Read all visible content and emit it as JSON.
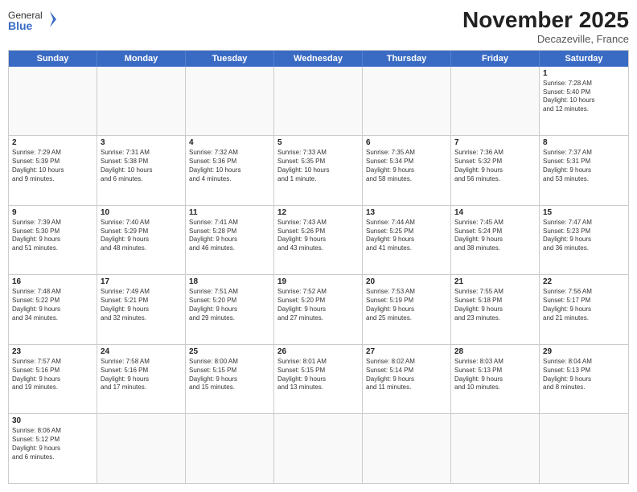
{
  "header": {
    "logo_general": "General",
    "logo_blue": "Blue",
    "month_title": "November 2025",
    "location": "Decazeville, France"
  },
  "day_headers": [
    "Sunday",
    "Monday",
    "Tuesday",
    "Wednesday",
    "Thursday",
    "Friday",
    "Saturday"
  ],
  "weeks": [
    {
      "days": [
        {
          "num": "",
          "info": ""
        },
        {
          "num": "",
          "info": ""
        },
        {
          "num": "",
          "info": ""
        },
        {
          "num": "",
          "info": ""
        },
        {
          "num": "",
          "info": ""
        },
        {
          "num": "",
          "info": ""
        },
        {
          "num": "1",
          "info": "Sunrise: 7:28 AM\nSunset: 5:40 PM\nDaylight: 10 hours\nand 12 minutes."
        }
      ]
    },
    {
      "days": [
        {
          "num": "2",
          "info": "Sunrise: 7:29 AM\nSunset: 5:39 PM\nDaylight: 10 hours\nand 9 minutes."
        },
        {
          "num": "3",
          "info": "Sunrise: 7:31 AM\nSunset: 5:38 PM\nDaylight: 10 hours\nand 6 minutes."
        },
        {
          "num": "4",
          "info": "Sunrise: 7:32 AM\nSunset: 5:36 PM\nDaylight: 10 hours\nand 4 minutes."
        },
        {
          "num": "5",
          "info": "Sunrise: 7:33 AM\nSunset: 5:35 PM\nDaylight: 10 hours\nand 1 minute."
        },
        {
          "num": "6",
          "info": "Sunrise: 7:35 AM\nSunset: 5:34 PM\nDaylight: 9 hours\nand 58 minutes."
        },
        {
          "num": "7",
          "info": "Sunrise: 7:36 AM\nSunset: 5:32 PM\nDaylight: 9 hours\nand 56 minutes."
        },
        {
          "num": "8",
          "info": "Sunrise: 7:37 AM\nSunset: 5:31 PM\nDaylight: 9 hours\nand 53 minutes."
        }
      ]
    },
    {
      "days": [
        {
          "num": "9",
          "info": "Sunrise: 7:39 AM\nSunset: 5:30 PM\nDaylight: 9 hours\nand 51 minutes."
        },
        {
          "num": "10",
          "info": "Sunrise: 7:40 AM\nSunset: 5:29 PM\nDaylight: 9 hours\nand 48 minutes."
        },
        {
          "num": "11",
          "info": "Sunrise: 7:41 AM\nSunset: 5:28 PM\nDaylight: 9 hours\nand 46 minutes."
        },
        {
          "num": "12",
          "info": "Sunrise: 7:43 AM\nSunset: 5:26 PM\nDaylight: 9 hours\nand 43 minutes."
        },
        {
          "num": "13",
          "info": "Sunrise: 7:44 AM\nSunset: 5:25 PM\nDaylight: 9 hours\nand 41 minutes."
        },
        {
          "num": "14",
          "info": "Sunrise: 7:45 AM\nSunset: 5:24 PM\nDaylight: 9 hours\nand 38 minutes."
        },
        {
          "num": "15",
          "info": "Sunrise: 7:47 AM\nSunset: 5:23 PM\nDaylight: 9 hours\nand 36 minutes."
        }
      ]
    },
    {
      "days": [
        {
          "num": "16",
          "info": "Sunrise: 7:48 AM\nSunset: 5:22 PM\nDaylight: 9 hours\nand 34 minutes."
        },
        {
          "num": "17",
          "info": "Sunrise: 7:49 AM\nSunset: 5:21 PM\nDaylight: 9 hours\nand 32 minutes."
        },
        {
          "num": "18",
          "info": "Sunrise: 7:51 AM\nSunset: 5:20 PM\nDaylight: 9 hours\nand 29 minutes."
        },
        {
          "num": "19",
          "info": "Sunrise: 7:52 AM\nSunset: 5:20 PM\nDaylight: 9 hours\nand 27 minutes."
        },
        {
          "num": "20",
          "info": "Sunrise: 7:53 AM\nSunset: 5:19 PM\nDaylight: 9 hours\nand 25 minutes."
        },
        {
          "num": "21",
          "info": "Sunrise: 7:55 AM\nSunset: 5:18 PM\nDaylight: 9 hours\nand 23 minutes."
        },
        {
          "num": "22",
          "info": "Sunrise: 7:56 AM\nSunset: 5:17 PM\nDaylight: 9 hours\nand 21 minutes."
        }
      ]
    },
    {
      "days": [
        {
          "num": "23",
          "info": "Sunrise: 7:57 AM\nSunset: 5:16 PM\nDaylight: 9 hours\nand 19 minutes."
        },
        {
          "num": "24",
          "info": "Sunrise: 7:58 AM\nSunset: 5:16 PM\nDaylight: 9 hours\nand 17 minutes."
        },
        {
          "num": "25",
          "info": "Sunrise: 8:00 AM\nSunset: 5:15 PM\nDaylight: 9 hours\nand 15 minutes."
        },
        {
          "num": "26",
          "info": "Sunrise: 8:01 AM\nSunset: 5:15 PM\nDaylight: 9 hours\nand 13 minutes."
        },
        {
          "num": "27",
          "info": "Sunrise: 8:02 AM\nSunset: 5:14 PM\nDaylight: 9 hours\nand 11 minutes."
        },
        {
          "num": "28",
          "info": "Sunrise: 8:03 AM\nSunset: 5:13 PM\nDaylight: 9 hours\nand 10 minutes."
        },
        {
          "num": "29",
          "info": "Sunrise: 8:04 AM\nSunset: 5:13 PM\nDaylight: 9 hours\nand 8 minutes."
        }
      ]
    },
    {
      "days": [
        {
          "num": "30",
          "info": "Sunrise: 8:06 AM\nSunset: 5:12 PM\nDaylight: 9 hours\nand 6 minutes."
        },
        {
          "num": "",
          "info": ""
        },
        {
          "num": "",
          "info": ""
        },
        {
          "num": "",
          "info": ""
        },
        {
          "num": "",
          "info": ""
        },
        {
          "num": "",
          "info": ""
        },
        {
          "num": "",
          "info": ""
        }
      ]
    }
  ]
}
